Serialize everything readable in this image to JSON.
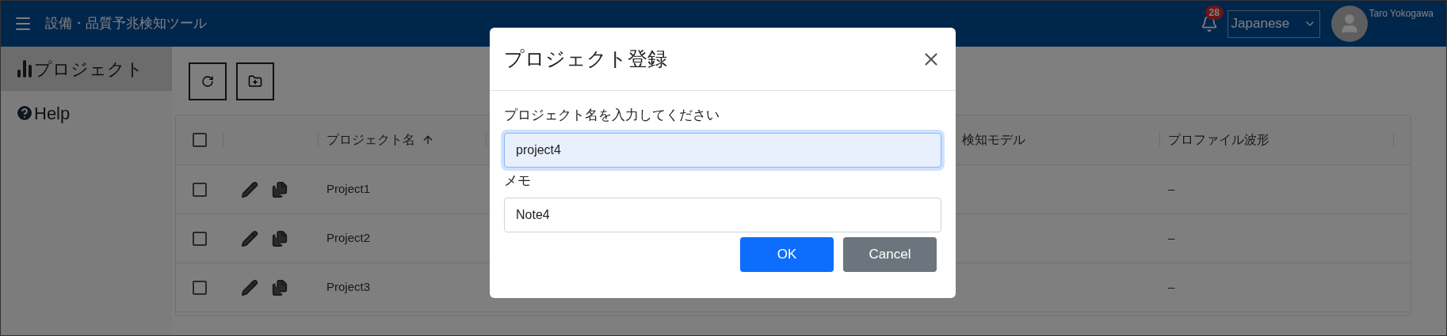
{
  "header": {
    "title": "設備・品質予兆検知ツール",
    "notification_count": "28",
    "language": "Japanese",
    "user": "Taro Yokogawa"
  },
  "sidebar": {
    "items": [
      {
        "label": "プロジェクト",
        "kind": "chart",
        "selected": true
      },
      {
        "label": "Help",
        "kind": "help",
        "selected": false
      }
    ]
  },
  "table": {
    "select_all": {
      "checked": false
    },
    "columns": [
      {
        "label": "プロジェクト名",
        "sorted": true
      },
      {
        "label": "検知モデル",
        "sorted": false
      },
      {
        "label": "プロファイル波形",
        "sorted": false
      }
    ],
    "rows": [
      {
        "name": "Project1",
        "profile": "–",
        "selected": false
      },
      {
        "name": "Project2",
        "profile": "–",
        "selected": false
      },
      {
        "name": "Project3",
        "profile": "–",
        "selected": false
      }
    ]
  },
  "dialog": {
    "title": "プロジェクト登録",
    "fields": [
      {
        "label": "プロジェクト名を入力してください",
        "value": "project4",
        "focused": true
      },
      {
        "label": "メモ",
        "value": "Note4",
        "focused": false
      }
    ],
    "buttons": [
      {
        "label": "OK",
        "kind": "primary"
      },
      {
        "label": "Cancel",
        "kind": "secondary"
      }
    ]
  }
}
